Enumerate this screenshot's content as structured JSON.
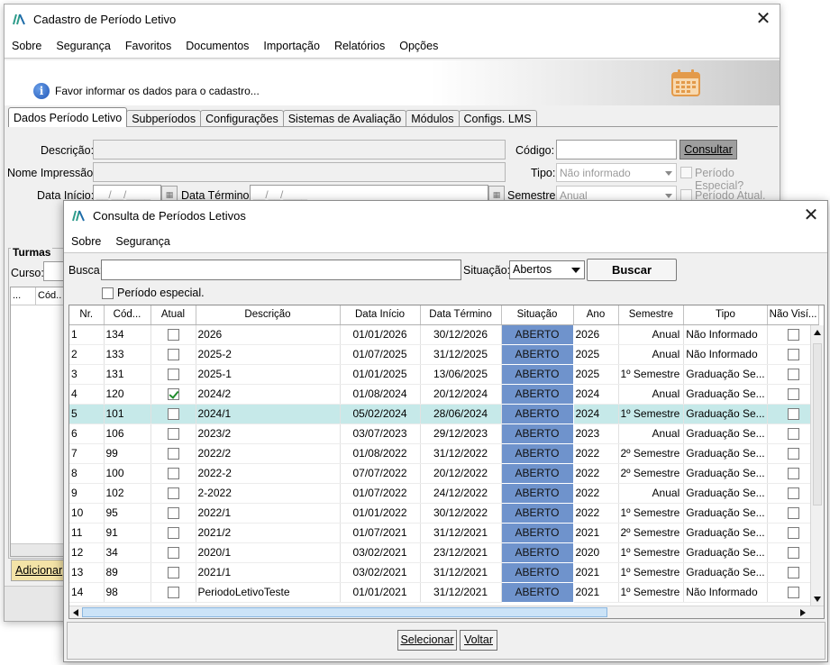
{
  "main": {
    "title": "Cadastro de Período Letivo",
    "menu": [
      "Sobre",
      "Segurança",
      "Favoritos",
      "Documentos",
      "Importação",
      "Relatórios",
      "Opções"
    ],
    "info_text": "Favor informar os dados para o cadastro...",
    "tabs": [
      "Dados Período Letivo",
      "Subperíodos",
      "Configurações",
      "Sistemas de Avaliação",
      "Módulos",
      "Configs. LMS"
    ],
    "labels": {
      "descricao": "Descrição:",
      "nome_impressao": "Nome Impressão:",
      "data_inicio": "Data Início:",
      "data_termino": "Data Término:",
      "codigo": "Código:",
      "tipo": "Tipo:",
      "semestre": "Semestre:",
      "periodo_especial": "Período Especial?",
      "periodo_atual": "Período Atual."
    },
    "values": {
      "data_inicio": "__/__/____",
      "data_termino": "__/__/____",
      "tipo": "Não informado",
      "semestre": "Anual"
    },
    "consultar_label": "Consultar",
    "turmas": {
      "title": "Turmas",
      "curso_label": "Curso:",
      "col_1": "...",
      "col_2": "Cód..",
      "adicionar_label": "Adicionar"
    }
  },
  "dialog": {
    "title": "Consulta de Períodos Letivos",
    "menu": [
      "Sobre",
      "Segurança"
    ],
    "busca_label": "Busca:",
    "busca_value": "",
    "situacao_label": "Situação:",
    "situacao_value": "Abertos",
    "buscar_label": "Buscar",
    "periodo_especial_label": "Período especial.",
    "columns": [
      "Nr.",
      "Cód...",
      "Atual",
      "Descrição",
      "Data Início",
      "Data Término",
      "Situação",
      "Ano",
      "Semestre",
      "Tipo",
      "Não Visí..."
    ],
    "rows": [
      {
        "nr": "1",
        "cod": "134",
        "atual": false,
        "desc": "2026",
        "inicio": "01/01/2026",
        "termino": "30/12/2026",
        "sit": "ABERTO",
        "ano": "2026",
        "sem": "Anual",
        "tipo": "Não Informado",
        "naovisivel": false
      },
      {
        "nr": "2",
        "cod": "133",
        "atual": false,
        "desc": "2025-2",
        "inicio": "01/07/2025",
        "termino": "31/12/2025",
        "sit": "ABERTO",
        "ano": "2025",
        "sem": "Anual",
        "tipo": "Não Informado",
        "naovisivel": false
      },
      {
        "nr": "3",
        "cod": "131",
        "atual": false,
        "desc": "2025-1",
        "inicio": "01/01/2025",
        "termino": "13/06/2025",
        "sit": "ABERTO",
        "ano": "2025",
        "sem": "1º Semestre",
        "tipo": "Graduação Se...",
        "naovisivel": false
      },
      {
        "nr": "4",
        "cod": "120",
        "atual": true,
        "desc": "2024/2",
        "inicio": "01/08/2024",
        "termino": "20/12/2024",
        "sit": "ABERTO",
        "ano": "2024",
        "sem": "Anual",
        "tipo": "Graduação Se...",
        "naovisivel": false
      },
      {
        "nr": "5",
        "cod": "101",
        "atual": false,
        "desc": "2024/1",
        "inicio": "05/02/2024",
        "termino": "28/06/2024",
        "sit": "ABERTO",
        "ano": "2024",
        "sem": "1º Semestre",
        "tipo": "Graduação Se...",
        "naovisivel": false,
        "selected": true
      },
      {
        "nr": "6",
        "cod": "106",
        "atual": false,
        "desc": "2023/2",
        "inicio": "03/07/2023",
        "termino": "29/12/2023",
        "sit": "ABERTO",
        "ano": "2023",
        "sem": "Anual",
        "tipo": "Graduação Se...",
        "naovisivel": false
      },
      {
        "nr": "7",
        "cod": "99",
        "atual": false,
        "desc": "2022/2",
        "inicio": "01/08/2022",
        "termino": "31/12/2022",
        "sit": "ABERTO",
        "ano": "2022",
        "sem": "2º Semestre",
        "tipo": "Graduação Se...",
        "naovisivel": false
      },
      {
        "nr": "8",
        "cod": "100",
        "atual": false,
        "desc": "2022-2",
        "inicio": "07/07/2022",
        "termino": "20/12/2022",
        "sit": "ABERTO",
        "ano": "2022",
        "sem": "2º Semestre",
        "tipo": "Graduação Se...",
        "naovisivel": false
      },
      {
        "nr": "9",
        "cod": "102",
        "atual": false,
        "desc": "2-2022",
        "inicio": "01/07/2022",
        "termino": "24/12/2022",
        "sit": "ABERTO",
        "ano": "2022",
        "sem": "Anual",
        "tipo": "Graduação Se...",
        "naovisivel": false
      },
      {
        "nr": "10",
        "cod": "95",
        "atual": false,
        "desc": "2022/1",
        "inicio": "01/01/2022",
        "termino": "30/12/2022",
        "sit": "ABERTO",
        "ano": "2022",
        "sem": "1º Semestre",
        "tipo": "Graduação Se...",
        "naovisivel": false
      },
      {
        "nr": "11",
        "cod": "91",
        "atual": false,
        "desc": "2021/2",
        "inicio": "01/07/2021",
        "termino": "31/12/2021",
        "sit": "ABERTO",
        "ano": "2021",
        "sem": "2º Semestre",
        "tipo": "Graduação Se...",
        "naovisivel": false
      },
      {
        "nr": "12",
        "cod": "34",
        "atual": false,
        "desc": "2020/1",
        "inicio": "03/02/2021",
        "termino": "23/12/2021",
        "sit": "ABERTO",
        "ano": "2020",
        "sem": "1º Semestre",
        "tipo": "Graduação Se...",
        "naovisivel": false
      },
      {
        "nr": "13",
        "cod": "89",
        "atual": false,
        "desc": "2021/1",
        "inicio": "03/02/2021",
        "termino": "31/12/2021",
        "sit": "ABERTO",
        "ano": "2021",
        "sem": "1º Semestre",
        "tipo": "Graduação Se...",
        "naovisivel": false
      },
      {
        "nr": "14",
        "cod": "98",
        "atual": false,
        "desc": "PeriodoLetivoTeste",
        "inicio": "01/01/2021",
        "termino": "31/12/2021",
        "sit": "ABERTO",
        "ano": "2021",
        "sem": "1º Semestre",
        "tipo": "Não Informado",
        "naovisivel": false
      }
    ],
    "selecionar_label": "Selecionar",
    "voltar_label": "Voltar"
  },
  "colors": {
    "situacao_cell": "#6f93cc",
    "selected_row": "#c6e9e9",
    "consultar_button": "#9e9e9e",
    "adicionar_button": "#f3e3a7",
    "check_green": "#1f8b2c"
  },
  "icons": [
    "app-logo-icon",
    "close-icon",
    "info-icon",
    "calendar-icon",
    "date-picker-icon",
    "dropdown-arrow-icon",
    "check-icon"
  ]
}
